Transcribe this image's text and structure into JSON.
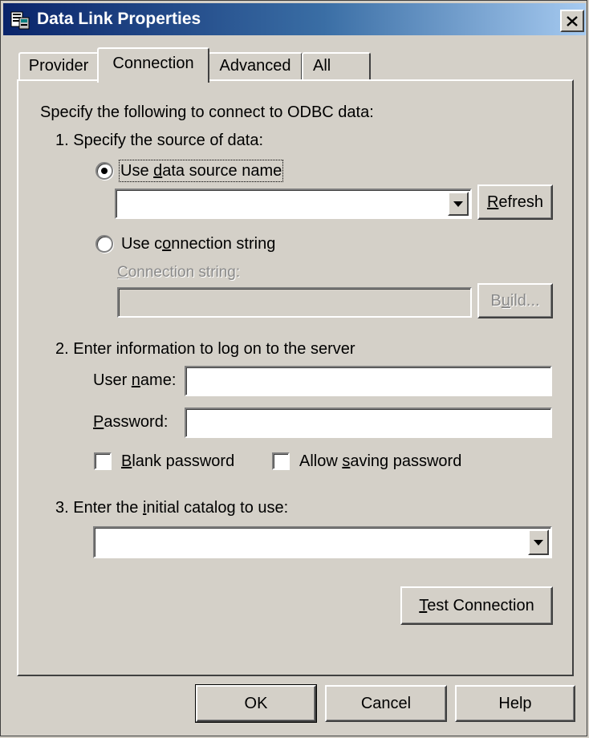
{
  "window": {
    "title": "Data Link Properties",
    "close_label": "×"
  },
  "tabs": [
    {
      "label": "Provider",
      "active": false
    },
    {
      "label": "Connection",
      "active": true
    },
    {
      "label": "Advanced",
      "active": false
    },
    {
      "label": "All",
      "active": false
    }
  ],
  "connection": {
    "intro": "Specify the following to connect to ODBC data:",
    "step1": {
      "heading": "1. Specify the source of data:",
      "option_dsn": {
        "pre": "Use ",
        "accel": "d",
        "post": "ata source name",
        "selected": true
      },
      "dsn_value": "",
      "refresh_button": {
        "accel": "R",
        "post": "efresh"
      },
      "option_connstr": {
        "pre": "Use c",
        "accel": "o",
        "post": "nnection string",
        "selected": false
      },
      "connstr_label": {
        "accel": "C",
        "post": "onnection string:"
      },
      "connstr_value": "",
      "build_button": {
        "pre": "B",
        "accel": "u",
        "post": "ild..."
      }
    },
    "step2": {
      "heading": "2. Enter information to log on to the server",
      "username_label": {
        "pre": "User ",
        "accel": "n",
        "post": "ame:"
      },
      "username_value": "",
      "password_label": {
        "accel": "P",
        "post": "assword:"
      },
      "password_value": "",
      "blank_password": {
        "accel": "B",
        "post": "lank password",
        "checked": false
      },
      "allow_saving": {
        "pre": "Allow ",
        "accel": "s",
        "post": "aving password",
        "checked": false
      }
    },
    "step3": {
      "heading_pre": "3. Enter the ",
      "heading_accel": "i",
      "heading_post": "nitial catalog to use:",
      "catalog_value": ""
    },
    "test_button": {
      "accel": "T",
      "post": "est Connection"
    }
  },
  "footer": {
    "ok_label": "OK",
    "cancel_label": "Cancel",
    "help_label": "Help"
  }
}
